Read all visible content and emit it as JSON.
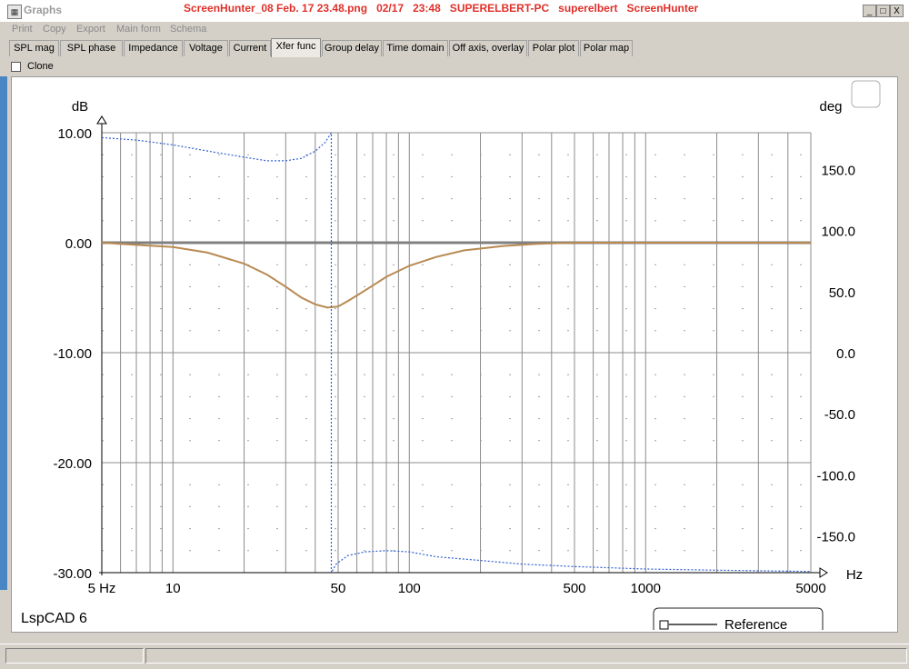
{
  "window": {
    "app_name": "Graphs",
    "capture_title": "ScreenHunter_08 Feb. 17 23.48.png   02/17   23:48   SUPERELBERT-PC   superelbert   ScreenHunter",
    "controls": {
      "minimize": "_",
      "maximize": "□",
      "close": "X"
    }
  },
  "menu": [
    "Print",
    "Copy",
    "Export",
    "Main form",
    "Schema"
  ],
  "tabs": [
    "SPL mag",
    "SPL phase",
    "Impedance",
    "Voltage",
    "Current",
    "Xfer func",
    "Group delay",
    "Time domain",
    "Off axis, overlay",
    "Polar plot",
    "Polar map"
  ],
  "active_tab": "Xfer func",
  "clone_label": "Clone",
  "product_label": "LspCAD 6",
  "legend": {
    "label": "Reference"
  },
  "chart_data": {
    "type": "line",
    "x_scale": "log",
    "xlim": [
      5,
      5000
    ],
    "ylim": [
      -30,
      10
    ],
    "y2lim": [
      -180,
      180
    ],
    "ylabel": "dB",
    "y2label": "deg",
    "xunit": "Hz",
    "x_tick_labels": [
      {
        "v": 5,
        "t": "5 Hz"
      },
      {
        "v": 10,
        "t": "10"
      },
      {
        "v": 50,
        "t": "50"
      },
      {
        "v": 100,
        "t": "100"
      },
      {
        "v": 500,
        "t": "500"
      },
      {
        "v": 1000,
        "t": "1000"
      },
      {
        "v": 5000,
        "t": "5000"
      }
    ],
    "y_tick_labels": [
      "10.00",
      "0.00",
      "-10.00",
      "-20.00",
      "-30.00"
    ],
    "y2_tick_labels": [
      "150.0",
      "100.0",
      "50.0",
      "0.0",
      "-50.0",
      "-100.0",
      "-150.0"
    ],
    "grid": true,
    "colors": {
      "magnitude": "#b88a52",
      "reference": "#808080",
      "phase": "#2f5fd0"
    },
    "series": [
      {
        "axis": "left",
        "x": [
          5,
          7,
          10,
          14,
          20,
          25,
          30,
          35,
          40,
          45,
          50,
          55,
          60,
          70,
          80,
          100,
          130,
          170,
          250,
          350,
          500,
          700,
          1000,
          2000,
          5000
        ],
        "values": [
          0,
          -0.2,
          -0.4,
          -0.9,
          -1.9,
          -2.9,
          -4.0,
          -5.0,
          -5.6,
          -5.9,
          -5.8,
          -5.3,
          -4.8,
          -3.9,
          -3.1,
          -2.1,
          -1.3,
          -0.7,
          -0.3,
          -0.1,
          0,
          0,
          0,
          0,
          0
        ]
      },
      {
        "axis": "left",
        "x": [
          5,
          5000
        ],
        "values": [
          0,
          0
        ]
      },
      {
        "axis": "right",
        "style": "dotted",
        "x": [
          5,
          7,
          10,
          15,
          20,
          25,
          30,
          35,
          40,
          44,
          46.8,
          46.8,
          49,
          55,
          65,
          80,
          100,
          130,
          200,
          300,
          500,
          1000,
          2000,
          5000
        ],
        "values": [
          176,
          174,
          170,
          164,
          160,
          157,
          157,
          159,
          165,
          172,
          180,
          -180,
          -173,
          -166,
          -163,
          -162,
          -163,
          -167,
          -170,
          -173,
          -175,
          -177,
          -178,
          -179
        ]
      }
    ]
  }
}
